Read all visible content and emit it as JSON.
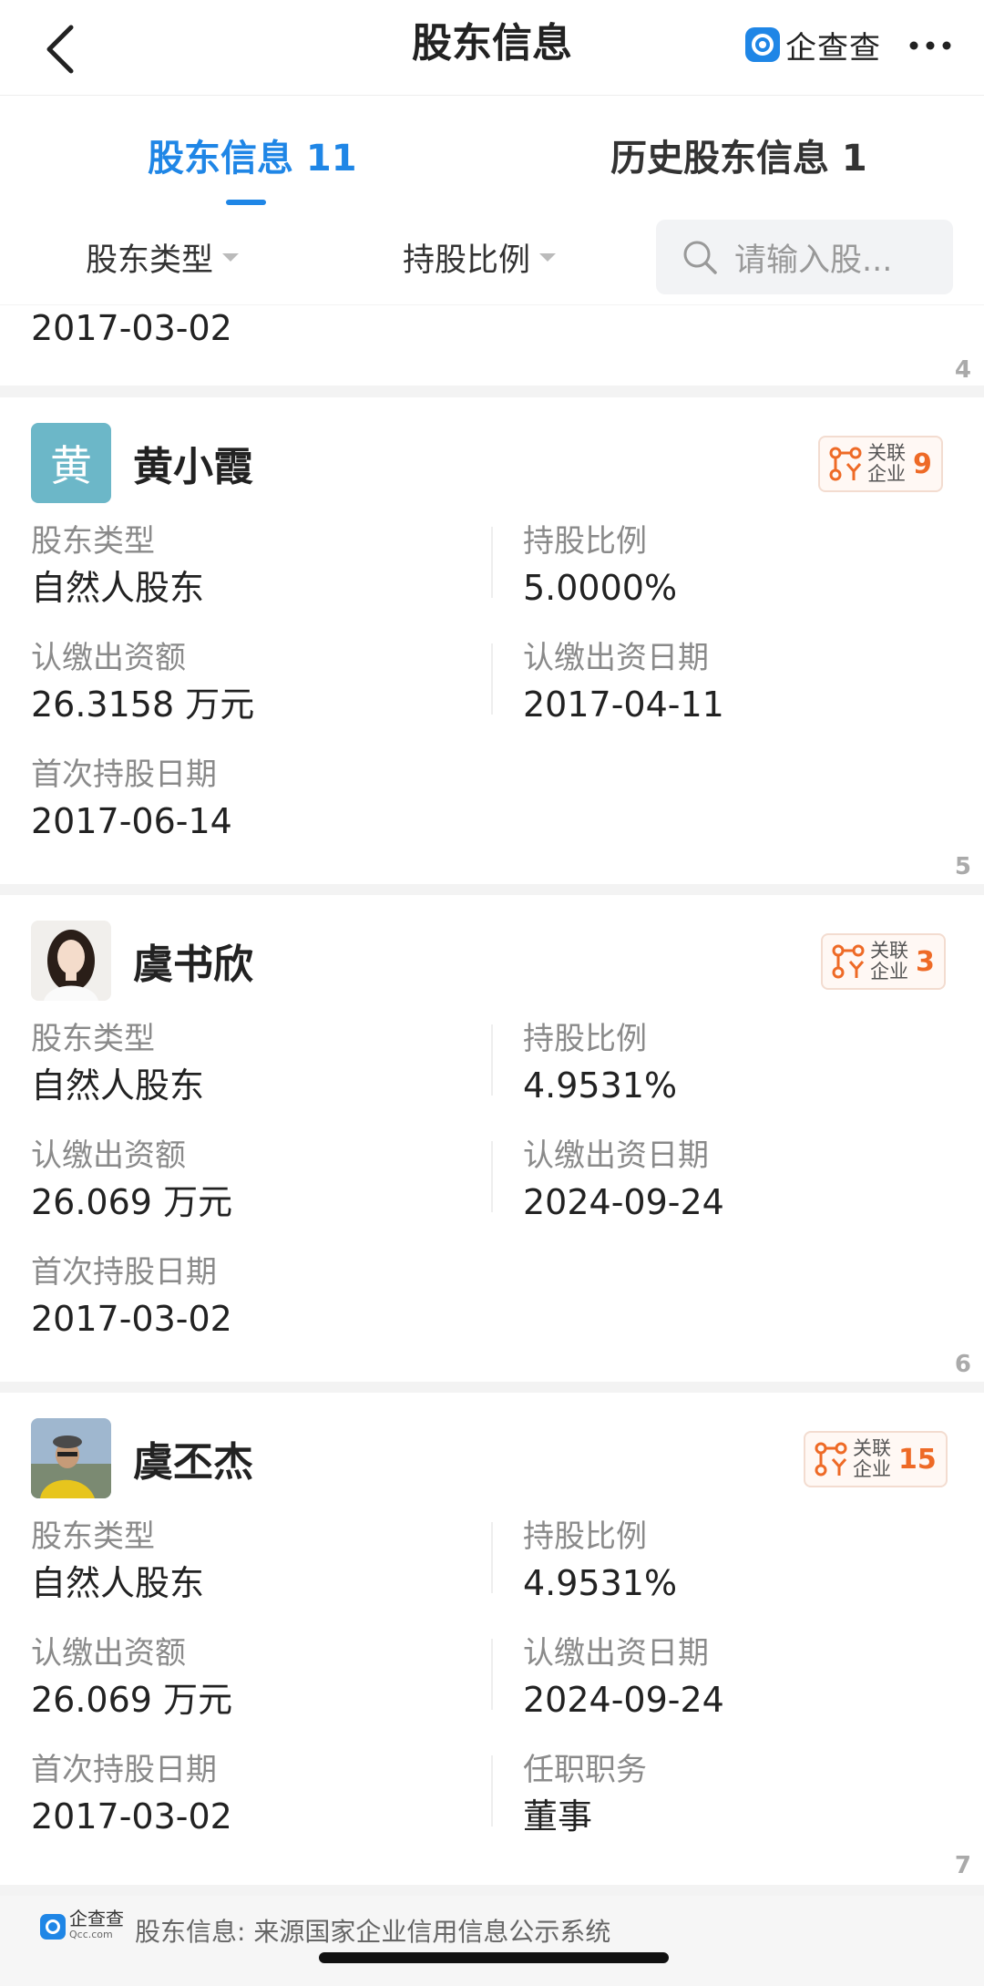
{
  "nav": {
    "title": "股东信息",
    "brand": "企查查",
    "back_icon": "chevron-left-icon",
    "more_icon": "more-icon"
  },
  "tabs": [
    {
      "label": "股东信息 11",
      "active": true
    },
    {
      "label": "历史股东信息 1",
      "active": false
    }
  ],
  "filters": {
    "type_label": "股东类型",
    "ratio_label": "持股比例",
    "search_placeholder": "请输入股..."
  },
  "partial_card": {
    "date": "2017-03-02",
    "index": "4"
  },
  "labels": {
    "holder_type": "股东类型",
    "ratio": "持股比例",
    "subscribed_amount": "认缴出资额",
    "subscribed_date": "认缴出资日期",
    "first_date": "首次持股日期",
    "position": "任职职务",
    "related_line1": "关联",
    "related_line2": "企业"
  },
  "shareholders": [
    {
      "index": "5",
      "name": "黄小霞",
      "avatar_char": "黄",
      "avatar_type": "text",
      "avatar_color": "#6cb7c8",
      "related_count": "9",
      "holder_type": "自然人股东",
      "ratio": "5.0000%",
      "amount": "26.3158",
      "amount_unit": "万元",
      "subscribed_date": "2017-04-11",
      "first_date": "2017-06-14"
    },
    {
      "index": "6",
      "name": "虞书欣",
      "avatar_type": "photo-woman",
      "related_count": "3",
      "holder_type": "自然人股东",
      "ratio": "4.9531%",
      "amount": "26.069",
      "amount_unit": "万元",
      "subscribed_date": "2024-09-24",
      "first_date": "2017-03-02"
    },
    {
      "index": "7",
      "name": "虞丕杰",
      "avatar_type": "photo-man",
      "related_count": "15",
      "holder_type": "自然人股东",
      "ratio": "4.9531%",
      "amount": "26.069",
      "amount_unit": "万元",
      "subscribed_date": "2024-09-24",
      "first_date": "2017-03-02",
      "position": "董事"
    }
  ],
  "footer": {
    "logo_text": "企查查",
    "logo_sub": "Qcc.com",
    "text": "股东信息: 来源国家企业信用信息公示系统"
  },
  "colors": {
    "accent": "#1f86e6",
    "related": "#ee6a26"
  }
}
